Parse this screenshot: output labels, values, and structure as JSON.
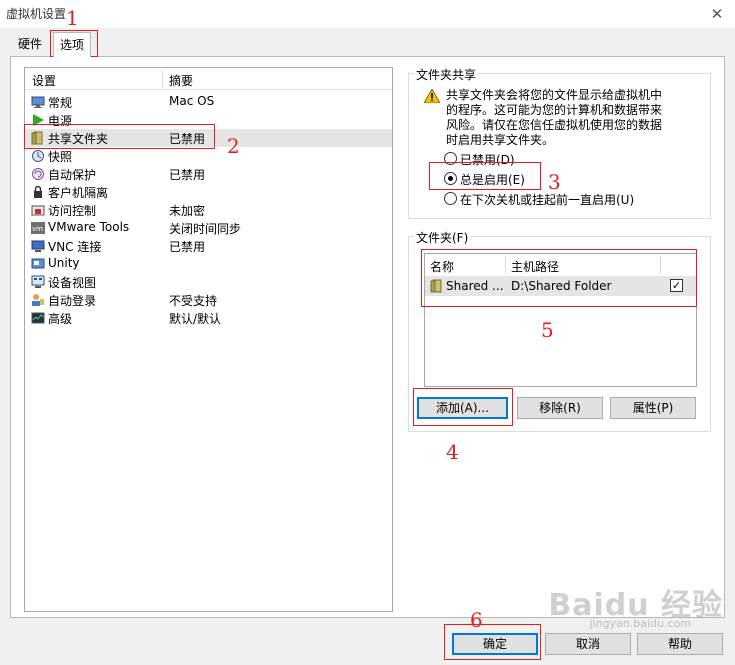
{
  "window": {
    "title": "虚拟机设置"
  },
  "tabs": [
    {
      "label": "硬件"
    },
    {
      "label": "选项"
    }
  ],
  "settings_list": {
    "col_setting": "设置",
    "col_summary": "摘要",
    "items": [
      {
        "name": "常规",
        "summary": "Mac OS",
        "icon": "monitor-icon"
      },
      {
        "name": "电源",
        "summary": "",
        "icon": "play-icon"
      },
      {
        "name": "共享文件夹",
        "summary": "已禁用",
        "icon": "shared-folder-icon"
      },
      {
        "name": "快照",
        "summary": "",
        "icon": "snapshot-icon"
      },
      {
        "name": "自动保护",
        "summary": "已禁用",
        "icon": "autoprotect-icon"
      },
      {
        "name": "客户机隔离",
        "summary": "",
        "icon": "lock-icon"
      },
      {
        "name": "访问控制",
        "summary": "未加密",
        "icon": "access-control-icon"
      },
      {
        "name": "VMware Tools",
        "summary": "关闭时间同步",
        "icon": "vmware-tools-icon"
      },
      {
        "name": "VNC 连接",
        "summary": "已禁用",
        "icon": "vnc-icon"
      },
      {
        "name": "Unity",
        "summary": "",
        "icon": "unity-icon"
      },
      {
        "name": "设备视图",
        "summary": "",
        "icon": "device-view-icon"
      },
      {
        "name": "自动登录",
        "summary": "不受支持",
        "icon": "autologin-icon"
      },
      {
        "name": "高级",
        "summary": "默认/默认",
        "icon": "advanced-icon"
      }
    ]
  },
  "sharing": {
    "legend": "文件夹共享",
    "warning": "共享文件夹会将您的文件显示给虚拟机中的程序。这可能为您的计算机和数据带来风险。请仅在您信任虚拟机使用您的数据时启用共享文件夹。",
    "options": [
      {
        "label": "已禁用(D)",
        "selected": false
      },
      {
        "label": "总是启用(E)",
        "selected": true
      },
      {
        "label": "在下次关机或挂起前一直启用(U)",
        "selected": false
      }
    ]
  },
  "folders": {
    "legend": "文件夹(F)",
    "col_name": "名称",
    "col_path": "主机路径",
    "rows": [
      {
        "name": "Shared ...",
        "path": "D:\\Shared Folder",
        "checked": true
      }
    ],
    "add_label": "添加(A)...",
    "remove_label": "移除(R)",
    "props_label": "属性(P)"
  },
  "footer": {
    "ok_label": "确定",
    "cancel_label": "取消",
    "help_label": "帮助"
  },
  "annotations": [
    "1",
    "2",
    "3",
    "4",
    "5",
    "6"
  ],
  "watermark": {
    "text": "Baidu 经验",
    "sub": "jingyan.baidu.com"
  },
  "colors": {
    "annotation": "#e02020",
    "selection": "#e5e5e5",
    "accent": "#0078d7"
  }
}
